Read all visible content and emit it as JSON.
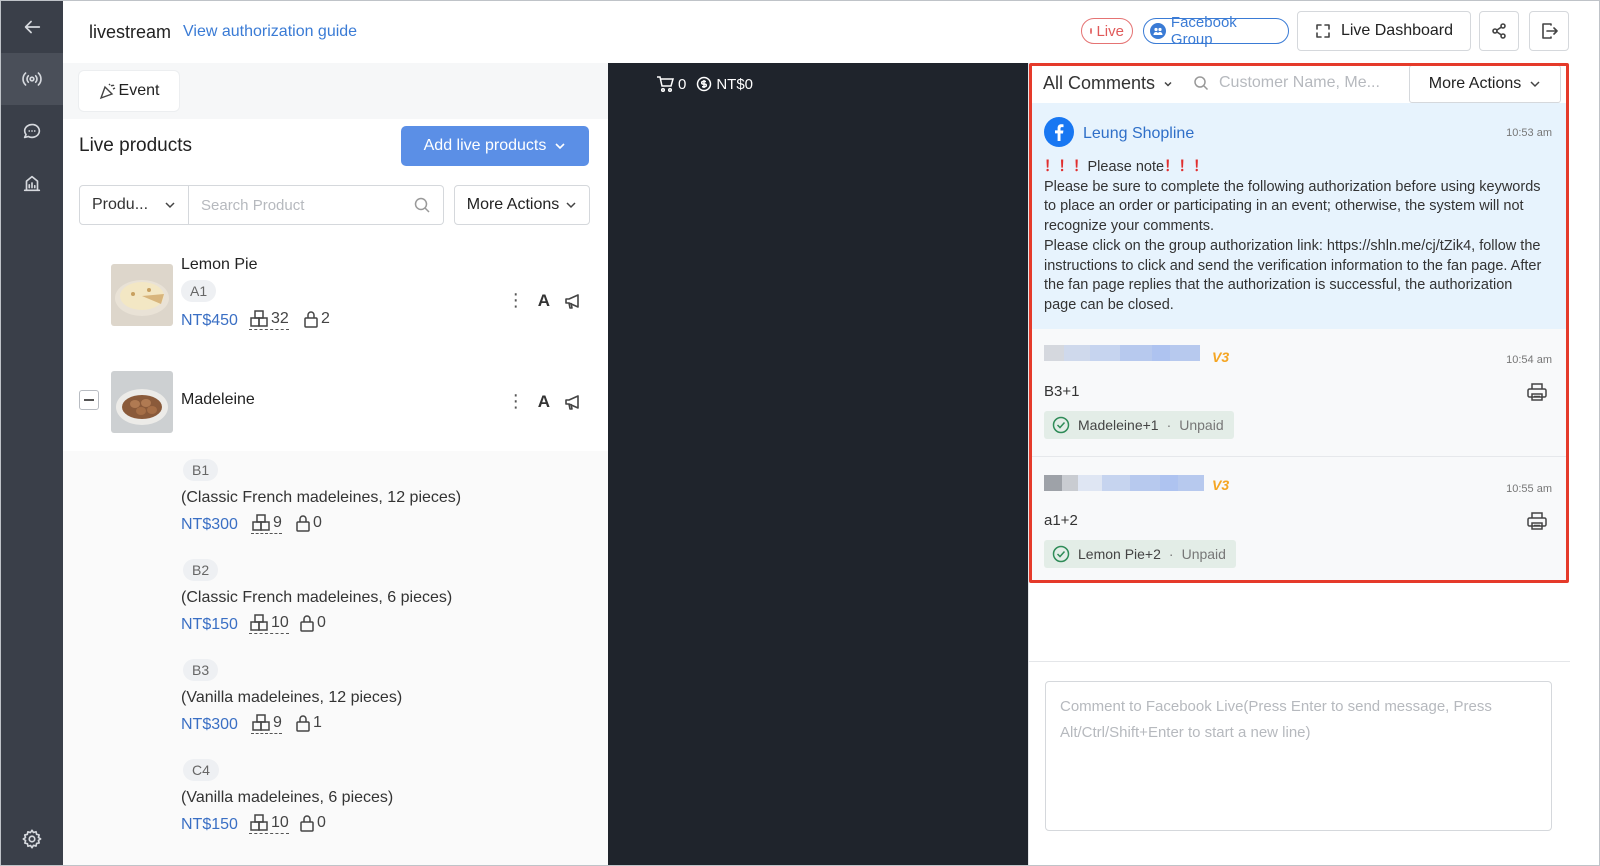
{
  "header": {
    "title": "livestream",
    "guide_link": "View authorization guide",
    "live_badge": "Live",
    "facebook_group": "Facebook Group",
    "live_dashboard": "Live Dashboard"
  },
  "sidebar": {
    "items": [
      {
        "name": "back-arrow-icon"
      },
      {
        "name": "broadcast-icon",
        "active": true
      },
      {
        "name": "chat-bubble-icon"
      },
      {
        "name": "analytics-icon"
      },
      {
        "name": "settings-gear-icon"
      }
    ]
  },
  "left_panel": {
    "event_button": "Event",
    "section_title": "Live products",
    "add_button": "Add live products",
    "filter_select": "Produ...",
    "search_placeholder": "Search Product",
    "more_actions": "More Actions",
    "products": [
      {
        "name": "Lemon Pie",
        "tag": "A1",
        "price": "NT$450",
        "stock": "32",
        "locked": "2"
      },
      {
        "name": "Madeleine",
        "variants": [
          {
            "tag": "B1",
            "desc": "(Classic French madeleines, 12 pieces)",
            "price": "NT$300",
            "stock": "9",
            "locked": "0"
          },
          {
            "tag": "B2",
            "desc": "(Classic French madeleines, 6 pieces)",
            "price": "NT$150",
            "stock": "10",
            "locked": "0"
          },
          {
            "tag": "B3",
            "desc": "(Vanilla madeleines, 12 pieces)",
            "price": "NT$300",
            "stock": "9",
            "locked": "1"
          },
          {
            "tag": "C4",
            "desc": "(Vanilla madeleines, 6 pieces)",
            "price": "NT$150",
            "stock": "10",
            "locked": "0"
          }
        ]
      }
    ]
  },
  "video": {
    "cart_count": "0",
    "amount": "NT$0"
  },
  "comments_panel": {
    "filter": "All Comments",
    "search_placeholder": "Customer Name, Me...",
    "more_actions": "More Actions",
    "comments": [
      {
        "author": "Leung Shopline",
        "time": "10:53 am",
        "warn_prefix": "！！！",
        "warn_title": "Please note",
        "warn_suffix": "！！！",
        "body_1": "Please be sure to complete the following authorization before using keywords to place an order or participating in an event; otherwise, the system will not recognize your comments.",
        "body_2": "Please click on the group authorization link: https://shln.me/cj/tZik4, follow the instructions to click and send the verification information to the fan page. After the fan page replies that the authorization is successful, the authorization page can be closed."
      },
      {
        "time": "10:54 am",
        "text": "B3+1",
        "order_item": "Madeleine+1",
        "order_status": "Unpaid",
        "badge": "V3"
      },
      {
        "time": "10:55 am",
        "text": "a1+2",
        "order_item": "Lemon Pie+2",
        "order_status": "Unpaid",
        "badge": "V3"
      }
    ],
    "composer_placeholder": "Comment to Facebook Live(Press Enter to send message, Press Alt/Ctrl/Shift+Enter to start a new line)"
  },
  "colors": {
    "accent": "#5b8fe6",
    "link": "#3a7bd5",
    "highlight": "#e53a2a",
    "rail": "#3a3f49",
    "video_bg": "#1f242c"
  }
}
